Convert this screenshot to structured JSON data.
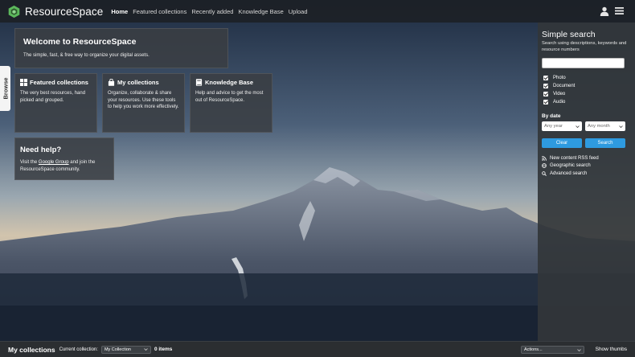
{
  "header": {
    "logo_text": "ResourceSpace",
    "nav": [
      "Home",
      "Featured collections",
      "Recently added",
      "Knowledge Base",
      "Upload"
    ],
    "active_nav": "Home",
    "icons": [
      "user-icon",
      "menu-icon"
    ]
  },
  "browse_tab": {
    "label": "Browse"
  },
  "welcome": {
    "title": "Welcome to ResourceSpace",
    "text": "The simple, fast, & free way to organize your digital assets."
  },
  "tiles": {
    "featured": {
      "title": "Featured collections",
      "text": "The very best resources, hand picked and grouped.",
      "icon": "grid-icon"
    },
    "mycoll": {
      "title": "My collections",
      "text": "Organize, collaborate & share your resources. Use these tools to help you work more effectively.",
      "icon": "shopping-bag-icon"
    },
    "kb": {
      "title": "Knowledge Base",
      "text": "Help and advice to get the most out of ResourceSpace.",
      "icon": "book-icon"
    }
  },
  "help": {
    "title": "Need help?",
    "text_before": "Visit the ",
    "link": "Google Group",
    "text_after": " and join the ResourceSpace community."
  },
  "search": {
    "title": "Simple search",
    "description": "Search using descriptions, keywords and resource numbers",
    "input_value": "",
    "types": [
      "Photo",
      "Document",
      "Video",
      "Audio"
    ],
    "by_date_label": "By date",
    "year_select": "Any year",
    "month_select": "Any month",
    "clear_label": "Clear",
    "search_label": "Search",
    "accent_color": "#2e9ae0",
    "links": [
      {
        "label": "New content RSS feed",
        "icon": "rss-icon"
      },
      {
        "label": "Geographic search",
        "icon": "globe-icon"
      },
      {
        "label": "Advanced search",
        "icon": "search-icon"
      }
    ]
  },
  "bottom_bar": {
    "title": "My collections",
    "current_label": "Current collection:",
    "current_value": "My Collection",
    "items": "0 items",
    "actions": "Actions...",
    "show_thumbs": "Show thumbs"
  }
}
